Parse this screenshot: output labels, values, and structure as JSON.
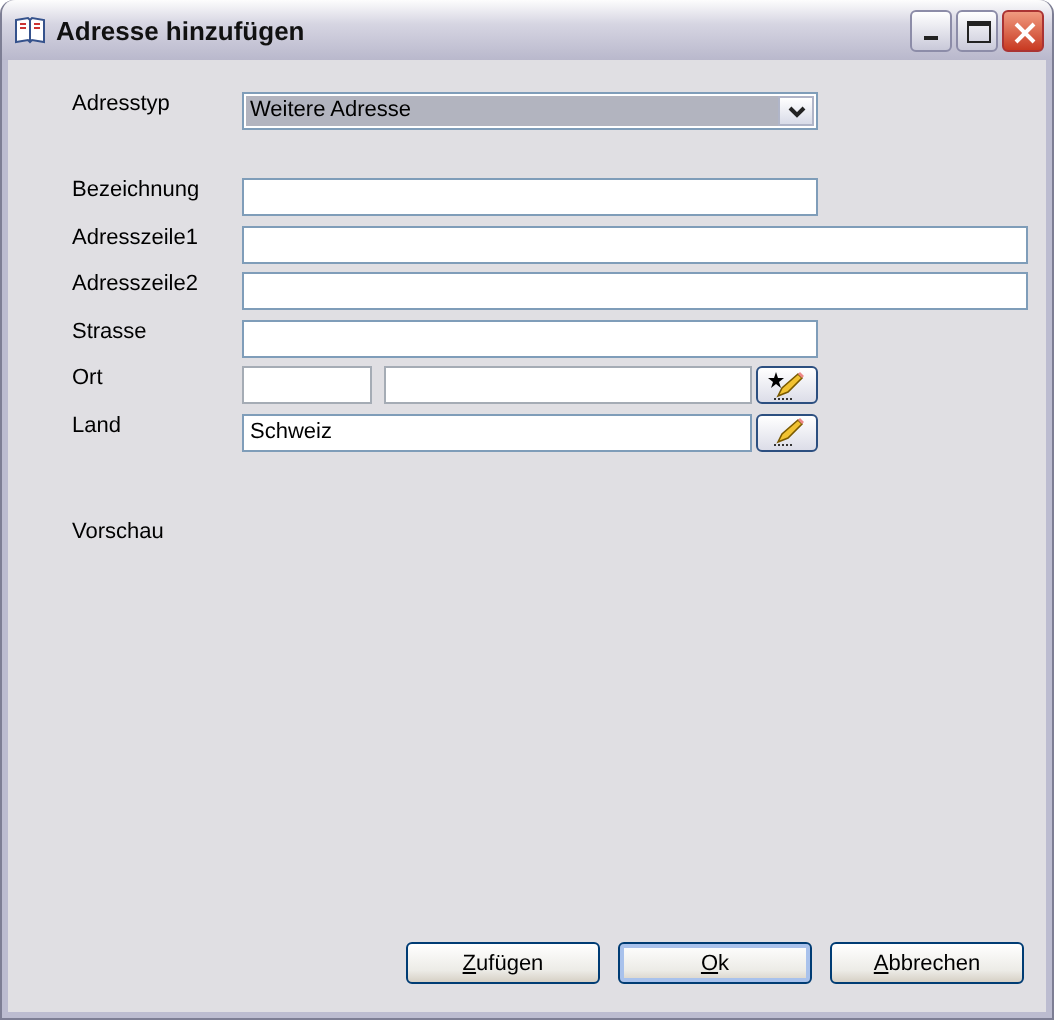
{
  "window": {
    "title": "Adresse hinzufügen"
  },
  "fields": [
    {
      "kind": "dropdown",
      "label": "Adresstyp",
      "value": "Weitere Adresse"
    },
    {
      "kind": "spacer"
    },
    {
      "kind": "text",
      "label": "Bezeichnung"
    },
    {
      "kind": "widetext",
      "label": "Adresszeile1"
    },
    {
      "kind": "widetext",
      "label": "Adresszeile2"
    },
    {
      "kind": "text",
      "label": "Strasse"
    },
    {
      "kind": "pair",
      "label": "Ort"
    },
    {
      "kind": "picker",
      "label": "Land",
      "value": "Schweiz"
    }
  ],
  "preview": {
    "label": "Vorschau"
  },
  "buttons": [
    {
      "label": "Zufügen",
      "default": false
    },
    {
      "label": "Ok",
      "default": true
    },
    {
      "label": "Abbrechen",
      "default": false
    }
  ]
}
